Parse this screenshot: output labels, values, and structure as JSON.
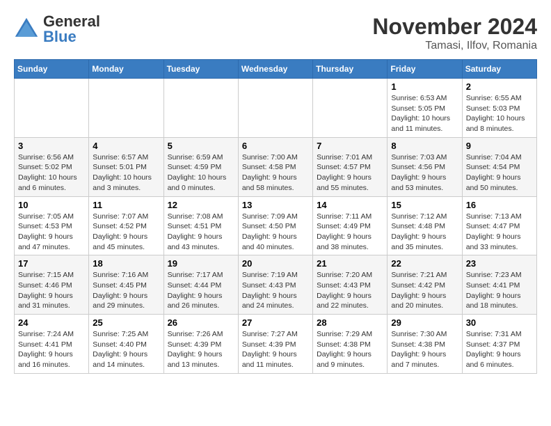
{
  "header": {
    "logo_general": "General",
    "logo_blue": "Blue",
    "month_title": "November 2024",
    "location": "Tamasi, Ilfov, Romania"
  },
  "days_of_week": [
    "Sunday",
    "Monday",
    "Tuesday",
    "Wednesday",
    "Thursday",
    "Friday",
    "Saturday"
  ],
  "weeks": [
    [
      {
        "day": "",
        "info": ""
      },
      {
        "day": "",
        "info": ""
      },
      {
        "day": "",
        "info": ""
      },
      {
        "day": "",
        "info": ""
      },
      {
        "day": "",
        "info": ""
      },
      {
        "day": "1",
        "info": "Sunrise: 6:53 AM\nSunset: 5:05 PM\nDaylight: 10 hours and 11 minutes."
      },
      {
        "day": "2",
        "info": "Sunrise: 6:55 AM\nSunset: 5:03 PM\nDaylight: 10 hours and 8 minutes."
      }
    ],
    [
      {
        "day": "3",
        "info": "Sunrise: 6:56 AM\nSunset: 5:02 PM\nDaylight: 10 hours and 6 minutes."
      },
      {
        "day": "4",
        "info": "Sunrise: 6:57 AM\nSunset: 5:01 PM\nDaylight: 10 hours and 3 minutes."
      },
      {
        "day": "5",
        "info": "Sunrise: 6:59 AM\nSunset: 4:59 PM\nDaylight: 10 hours and 0 minutes."
      },
      {
        "day": "6",
        "info": "Sunrise: 7:00 AM\nSunset: 4:58 PM\nDaylight: 9 hours and 58 minutes."
      },
      {
        "day": "7",
        "info": "Sunrise: 7:01 AM\nSunset: 4:57 PM\nDaylight: 9 hours and 55 minutes."
      },
      {
        "day": "8",
        "info": "Sunrise: 7:03 AM\nSunset: 4:56 PM\nDaylight: 9 hours and 53 minutes."
      },
      {
        "day": "9",
        "info": "Sunrise: 7:04 AM\nSunset: 4:54 PM\nDaylight: 9 hours and 50 minutes."
      }
    ],
    [
      {
        "day": "10",
        "info": "Sunrise: 7:05 AM\nSunset: 4:53 PM\nDaylight: 9 hours and 47 minutes."
      },
      {
        "day": "11",
        "info": "Sunrise: 7:07 AM\nSunset: 4:52 PM\nDaylight: 9 hours and 45 minutes."
      },
      {
        "day": "12",
        "info": "Sunrise: 7:08 AM\nSunset: 4:51 PM\nDaylight: 9 hours and 43 minutes."
      },
      {
        "day": "13",
        "info": "Sunrise: 7:09 AM\nSunset: 4:50 PM\nDaylight: 9 hours and 40 minutes."
      },
      {
        "day": "14",
        "info": "Sunrise: 7:11 AM\nSunset: 4:49 PM\nDaylight: 9 hours and 38 minutes."
      },
      {
        "day": "15",
        "info": "Sunrise: 7:12 AM\nSunset: 4:48 PM\nDaylight: 9 hours and 35 minutes."
      },
      {
        "day": "16",
        "info": "Sunrise: 7:13 AM\nSunset: 4:47 PM\nDaylight: 9 hours and 33 minutes."
      }
    ],
    [
      {
        "day": "17",
        "info": "Sunrise: 7:15 AM\nSunset: 4:46 PM\nDaylight: 9 hours and 31 minutes."
      },
      {
        "day": "18",
        "info": "Sunrise: 7:16 AM\nSunset: 4:45 PM\nDaylight: 9 hours and 29 minutes."
      },
      {
        "day": "19",
        "info": "Sunrise: 7:17 AM\nSunset: 4:44 PM\nDaylight: 9 hours and 26 minutes."
      },
      {
        "day": "20",
        "info": "Sunrise: 7:19 AM\nSunset: 4:43 PM\nDaylight: 9 hours and 24 minutes."
      },
      {
        "day": "21",
        "info": "Sunrise: 7:20 AM\nSunset: 4:43 PM\nDaylight: 9 hours and 22 minutes."
      },
      {
        "day": "22",
        "info": "Sunrise: 7:21 AM\nSunset: 4:42 PM\nDaylight: 9 hours and 20 minutes."
      },
      {
        "day": "23",
        "info": "Sunrise: 7:23 AM\nSunset: 4:41 PM\nDaylight: 9 hours and 18 minutes."
      }
    ],
    [
      {
        "day": "24",
        "info": "Sunrise: 7:24 AM\nSunset: 4:41 PM\nDaylight: 9 hours and 16 minutes."
      },
      {
        "day": "25",
        "info": "Sunrise: 7:25 AM\nSunset: 4:40 PM\nDaylight: 9 hours and 14 minutes."
      },
      {
        "day": "26",
        "info": "Sunrise: 7:26 AM\nSunset: 4:39 PM\nDaylight: 9 hours and 13 minutes."
      },
      {
        "day": "27",
        "info": "Sunrise: 7:27 AM\nSunset: 4:39 PM\nDaylight: 9 hours and 11 minutes."
      },
      {
        "day": "28",
        "info": "Sunrise: 7:29 AM\nSunset: 4:38 PM\nDaylight: 9 hours and 9 minutes."
      },
      {
        "day": "29",
        "info": "Sunrise: 7:30 AM\nSunset: 4:38 PM\nDaylight: 9 hours and 7 minutes."
      },
      {
        "day": "30",
        "info": "Sunrise: 7:31 AM\nSunset: 4:37 PM\nDaylight: 9 hours and 6 minutes."
      }
    ]
  ]
}
